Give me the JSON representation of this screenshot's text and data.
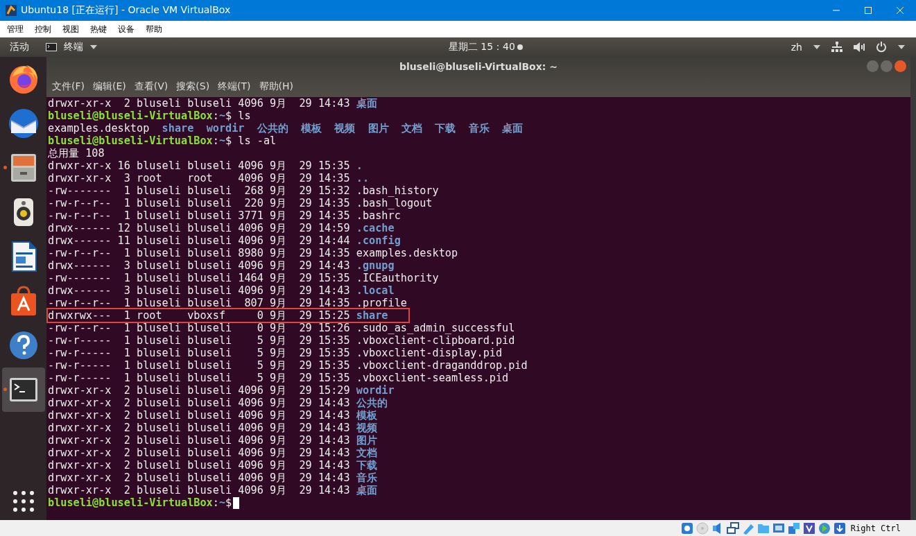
{
  "window": {
    "title": "Ubuntu18 [正在运行] - Oracle VM VirtualBox"
  },
  "menu": [
    "管理",
    "控制",
    "视图",
    "热键",
    "设备",
    "帮助"
  ],
  "top_bar": {
    "activities": "活动",
    "app": "终端",
    "clock": "星期二 15：40",
    "input": "zh"
  },
  "dock": {
    "items": [
      {
        "kind": "browser",
        "running": false,
        "selected": false
      },
      {
        "kind": "mail",
        "running": false,
        "selected": false
      },
      {
        "kind": "files",
        "running": true,
        "selected": false
      },
      {
        "kind": "music",
        "running": false,
        "selected": false
      },
      {
        "kind": "writer",
        "running": false,
        "selected": false
      },
      {
        "kind": "store",
        "running": false,
        "selected": false
      },
      {
        "kind": "help",
        "running": false,
        "selected": false
      },
      {
        "kind": "terminal",
        "running": true,
        "selected": true
      }
    ]
  },
  "terminal": {
    "title": "bluseli@bluseli-VirtualBox: ~",
    "menu": [
      "文件(F)",
      "编辑(E)",
      "查看(V)",
      "搜索(S)",
      "终端(T)",
      "帮助(H)"
    ],
    "lines": [
      {
        "kind": "entry",
        "info": "drwxr-xr-x  2 bluseli bluseli 4096 9月  29 14:43",
        "name": "桌面",
        "dir": true,
        "highlighted": false
      },
      {
        "kind": "prompt",
        "user": "bluseli@bluseli-VirtualBox",
        "separator": ":",
        "path": "~",
        "symbol": "$",
        "command": "ls"
      },
      {
        "kind": "names",
        "items": [
          {
            "name": "examples.desktop",
            "dir": false
          },
          {
            "name": "share",
            "dir": true
          },
          {
            "name": "wordir",
            "dir": true
          },
          {
            "name": "公共的",
            "dir": true
          },
          {
            "name": "模板",
            "dir": true
          },
          {
            "name": "视频",
            "dir": true
          },
          {
            "name": "图片",
            "dir": true
          },
          {
            "name": "文档",
            "dir": true
          },
          {
            "name": "下载",
            "dir": true
          },
          {
            "name": "音乐",
            "dir": true
          },
          {
            "name": "桌面",
            "dir": true
          }
        ]
      },
      {
        "kind": "prompt",
        "user": "bluseli@bluseli-VirtualBox",
        "separator": ":",
        "path": "~",
        "symbol": "$",
        "command": "ls -al"
      },
      {
        "kind": "text",
        "text": "总用量 108"
      },
      {
        "kind": "entry",
        "info": "drwxr-xr-x 16 bluseli bluseli 4096 9月  29 15:35",
        "name": ".",
        "dir": true,
        "highlighted": false
      },
      {
        "kind": "entry",
        "info": "drwxr-xr-x  3 root    root    4096 9月  29 14:35",
        "name": "..",
        "dir": true,
        "highlighted": false
      },
      {
        "kind": "entry",
        "info": "-rw-------  1 bluseli bluseli  268 9月  29 15:32",
        "name": ".bash_history",
        "dir": false,
        "highlighted": false
      },
      {
        "kind": "entry",
        "info": "-rw-r--r--  1 bluseli bluseli  220 9月  29 14:35",
        "name": ".bash_logout",
        "dir": false,
        "highlighted": false
      },
      {
        "kind": "entry",
        "info": "-rw-r--r--  1 bluseli bluseli 3771 9月  29 14:35",
        "name": ".bashrc",
        "dir": false,
        "highlighted": false
      },
      {
        "kind": "entry",
        "info": "drwx------ 12 bluseli bluseli 4096 9月  29 14:59",
        "name": ".cache",
        "dir": true,
        "highlighted": false
      },
      {
        "kind": "entry",
        "info": "drwx------ 11 bluseli bluseli 4096 9月  29 14:44",
        "name": ".config",
        "dir": true,
        "highlighted": false
      },
      {
        "kind": "entry",
        "info": "-rw-r--r--  1 bluseli bluseli 8980 9月  29 14:35",
        "name": "examples.desktop",
        "dir": false,
        "highlighted": false
      },
      {
        "kind": "entry",
        "info": "drwx------  3 bluseli bluseli 4096 9月  29 14:43",
        "name": ".gnupg",
        "dir": true,
        "highlighted": false
      },
      {
        "kind": "entry",
        "info": "-rw-------  1 bluseli bluseli 1464 9月  29 15:35",
        "name": ".ICEauthority",
        "dir": false,
        "highlighted": false
      },
      {
        "kind": "entry",
        "info": "drwx------  3 bluseli bluseli 4096 9月  29 14:43",
        "name": ".local",
        "dir": true,
        "highlighted": false
      },
      {
        "kind": "entry",
        "info": "-rw-r--r--  1 bluseli bluseli  807 9月  29 14:35",
        "name": ".profile",
        "dir": false,
        "highlighted": false
      },
      {
        "kind": "entry",
        "info": "drwxrwx---  1 root    vboxsf     0 9月  29 15:25",
        "name": "share",
        "dir": true,
        "highlighted": true
      },
      {
        "kind": "entry",
        "info": "-rw-r--r--  1 bluseli bluseli    0 9月  29 15:26",
        "name": ".sudo_as_admin_successful",
        "dir": false,
        "highlighted": false
      },
      {
        "kind": "entry",
        "info": "-rw-r-----  1 bluseli bluseli    5 9月  29 15:35",
        "name": ".vboxclient-clipboard.pid",
        "dir": false,
        "highlighted": false
      },
      {
        "kind": "entry",
        "info": "-rw-r-----  1 bluseli bluseli    5 9月  29 15:35",
        "name": ".vboxclient-display.pid",
        "dir": false,
        "highlighted": false
      },
      {
        "kind": "entry",
        "info": "-rw-r-----  1 bluseli bluseli    5 9月  29 15:35",
        "name": ".vboxclient-draganddrop.pid",
        "dir": false,
        "highlighted": false
      },
      {
        "kind": "entry",
        "info": "-rw-r-----  1 bluseli bluseli    5 9月  29 15:35",
        "name": ".vboxclient-seamless.pid",
        "dir": false,
        "highlighted": false
      },
      {
        "kind": "entry",
        "info": "drwxr-xr-x  2 bluseli bluseli 4096 9月  29 15:29",
        "name": "wordir",
        "dir": true,
        "highlighted": false
      },
      {
        "kind": "entry",
        "info": "drwxr-xr-x  2 bluseli bluseli 4096 9月  29 14:43",
        "name": "公共的",
        "dir": true,
        "highlighted": false
      },
      {
        "kind": "entry",
        "info": "drwxr-xr-x  2 bluseli bluseli 4096 9月  29 14:43",
        "name": "模板",
        "dir": true,
        "highlighted": false
      },
      {
        "kind": "entry",
        "info": "drwxr-xr-x  2 bluseli bluseli 4096 9月  29 14:43",
        "name": "视频",
        "dir": true,
        "highlighted": false
      },
      {
        "kind": "entry",
        "info": "drwxr-xr-x  2 bluseli bluseli 4096 9月  29 14:43",
        "name": "图片",
        "dir": true,
        "highlighted": false
      },
      {
        "kind": "entry",
        "info": "drwxr-xr-x  2 bluseli bluseli 4096 9月  29 14:43",
        "name": "文档",
        "dir": true,
        "highlighted": false
      },
      {
        "kind": "entry",
        "info": "drwxr-xr-x  2 bluseli bluseli 4096 9月  29 14:43",
        "name": "下载",
        "dir": true,
        "highlighted": false
      },
      {
        "kind": "entry",
        "info": "drwxr-xr-x  2 bluseli bluseli 4096 9月  29 14:43",
        "name": "音乐",
        "dir": true,
        "highlighted": false
      },
      {
        "kind": "entry",
        "info": "drwxr-xr-x  2 bluseli bluseli 4096 9月  29 14:43",
        "name": "桌面",
        "dir": true,
        "highlighted": false
      },
      {
        "kind": "prompt",
        "user": "bluseli@bluseli-VirtualBox",
        "separator": ":",
        "path": "~",
        "symbol": "$",
        "cursor": true
      }
    ]
  },
  "status_bar": {
    "host_key": "Right Ctrl"
  }
}
